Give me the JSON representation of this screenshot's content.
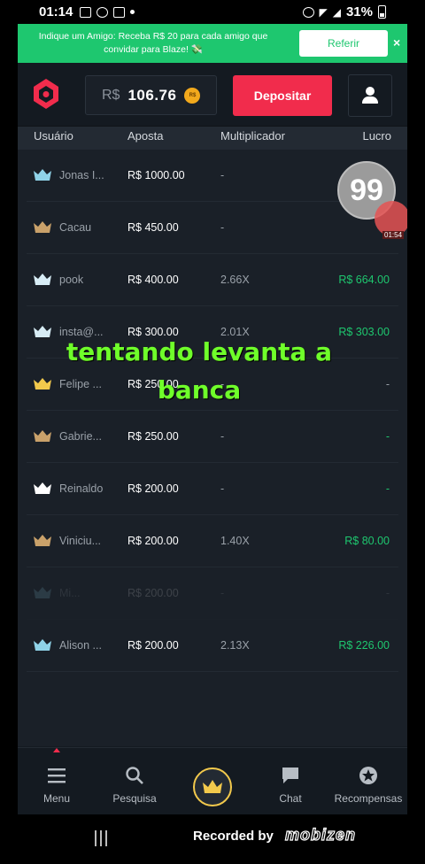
{
  "status_bar": {
    "time": "01:14",
    "battery": "31%"
  },
  "promo": {
    "text": "Indique um Amigo: Receba R$ 20 para cada amigo que convidar para Blaze! 💸",
    "button": "Referir",
    "close": "×"
  },
  "header": {
    "currency": "R$",
    "balance": "106.76",
    "coin_label": "R$",
    "deposit": "Depositar"
  },
  "table": {
    "columns": [
      "Usuário",
      "Aposta",
      "Multiplicador",
      "Lucro"
    ],
    "rows": [
      {
        "user": "Jonas I...",
        "bet": "R$ 1000.00",
        "mult": "-",
        "profit": "",
        "crown": "#8fd3e8",
        "win": false
      },
      {
        "user": "Cacau",
        "bet": "R$ 450.00",
        "mult": "-",
        "profit": "",
        "crown": "#c9a16a",
        "win": false
      },
      {
        "user": "pook",
        "bet": "R$ 400.00",
        "mult": "2.66X",
        "profit": "R$ 664.00",
        "crown": "#d7ecf5",
        "win": true
      },
      {
        "user": "insta@...",
        "bet": "R$ 300.00",
        "mult": "2.01X",
        "profit": "R$ 303.00",
        "crown": "#d7ecf5",
        "win": true
      },
      {
        "user": "Felipe ...",
        "bet": "R$ 250.00",
        "mult": "-",
        "profit": "-",
        "crown": "#f2c94c",
        "win": false
      },
      {
        "user": "Gabrie...",
        "bet": "R$ 250.00",
        "mult": "-",
        "profit": "-",
        "crown": "#c9a16a",
        "win": true
      },
      {
        "user": "Reinaldo",
        "bet": "R$ 200.00",
        "mult": "-",
        "profit": "-",
        "crown": "#ffffff",
        "win": true
      },
      {
        "user": "Viniciu...",
        "bet": "R$ 200.00",
        "mult": "1.40X",
        "profit": "R$ 80.00",
        "crown": "#c9a16a",
        "win": true
      },
      {
        "user": "Mi...",
        "bet": "R$ 200.00",
        "mult": "-",
        "profit": "-",
        "crown": "#8fd3e8",
        "win": false,
        "faded": true
      },
      {
        "user": "Alison ...",
        "bet": "R$ 200.00",
        "mult": "2.13X",
        "profit": "R$ 226.00",
        "crown": "#8fd3e8",
        "win": true
      }
    ]
  },
  "overlay": {
    "badge": "99",
    "rec_time": "01:54"
  },
  "caption": {
    "line1": "tentando levanta a",
    "line2": "banca"
  },
  "bottom_nav": {
    "items": [
      "Menu",
      "Pesquisa",
      "",
      "Chat",
      "Recompensas"
    ]
  },
  "recorder": {
    "recorded_by": "Recorded by",
    "brand": "mobizen"
  },
  "colors": {
    "accent_green": "#1ec76f",
    "deposit_red": "#f12c4c",
    "background": "#141a21"
  }
}
